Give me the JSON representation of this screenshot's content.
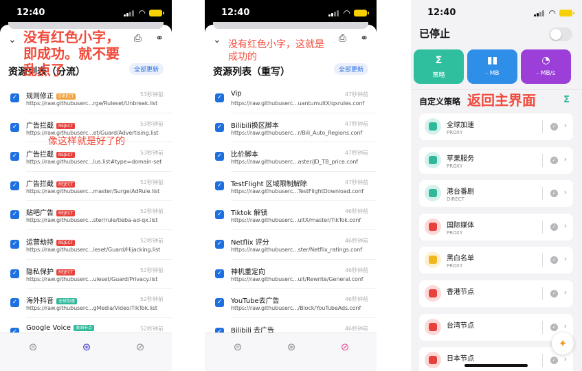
{
  "panel1": {
    "status": {
      "time": "12:40"
    },
    "title": "资源列表（分流）",
    "update_btn": "全部更新",
    "rows": [
      {
        "name": "规则修正",
        "badge": "DIRECT",
        "badge_color": "#f2a23c",
        "url": "https://raw.githubuserc...rge/Ruleset/Unbreak.list",
        "ago": "53秒钟前"
      },
      {
        "name": "广告拦截",
        "badge": "REJECT",
        "badge_color": "#e8413b",
        "url": "https://raw.githubuserc...et/Guard/Advertising.list",
        "ago": "53秒钟前"
      },
      {
        "name": "广告拦截",
        "badge": "REJECT",
        "badge_color": "#e8413b",
        "url": "https://raw.githubuserc...lus.list#type=domain-set",
        "ago": "53秒钟前"
      },
      {
        "name": "广告拦截",
        "badge": "REJECT",
        "badge_color": "#e8413b",
        "url": "https://raw.githubuserc...master/Surge/AdRule.list",
        "ago": "52秒钟前"
      },
      {
        "name": "贴吧广告",
        "badge": "REJECT",
        "badge_color": "#e8413b",
        "url": "https://raw.githubuserc...ster/rule/tieba-ad-qx.list",
        "ago": "52秒钟前"
      },
      {
        "name": "运营劫持",
        "badge": "REJECT",
        "badge_color": "#e8413b",
        "url": "https://raw.githubuserc...leset/Guard/Hijacking.list",
        "ago": "52秒钟前"
      },
      {
        "name": "隐私保护",
        "badge": "REJECT",
        "badge_color": "#e8413b",
        "url": "https://raw.githubuserc...uleset/Guard/Privacy.list",
        "ago": "52秒钟前"
      },
      {
        "name": "海外抖音",
        "badge": "全球加速",
        "badge_color": "#2fb89a",
        "url": "https://raw.githubuserc...gMedia/Video/TikTok.list",
        "ago": "52秒钟前"
      },
      {
        "name": "Google Voice",
        "badge": "美国节点",
        "badge_color": "#2fb89a",
        "url": "",
        "ago": "52秒钟前"
      }
    ],
    "annotations": {
      "big": "没有红色小字，\n即成功。就不要\n乱点了",
      "mid": "像这样就是好了的"
    }
  },
  "panel2": {
    "status": {
      "time": "12:40"
    },
    "title": "资源列表（重写）",
    "update_btn": "全部更新",
    "rows": [
      {
        "name": "Vip",
        "url": "https://raw.githubuserc...uantumultX/qxrules.conf",
        "ago": "47秒钟前"
      },
      {
        "name": "Bilibili换区脚本",
        "url": "https://raw.githubuserc...r/Bili_Auto_Regions.conf",
        "ago": "47秒钟前"
      },
      {
        "name": "比价脚本",
        "url": "https://raw.githubuserc...aster/JD_TB_price.conf",
        "ago": "47秒钟前"
      },
      {
        "name": "TestFlight 区域限制解除",
        "url": "https://raw.githubuserc...TestFlightDownload.conf",
        "ago": "47秒钟前"
      },
      {
        "name": "Tiktok 解锁",
        "url": "https://raw.githubuserc...ultX/master/TikTok.conf",
        "ago": "46秒钟前"
      },
      {
        "name": "Netflix 评分",
        "url": "https://raw.githubuserc...ster/Netflix_ratings.conf",
        "ago": "46秒钟前"
      },
      {
        "name": "神机重定向",
        "url": "https://raw.githubuserc...ult/Rewrite/General.conf",
        "ago": "46秒钟前"
      },
      {
        "name": "YouTube去广告",
        "url": "https://raw.githubuserc.../Block/YouTubeAds.conf",
        "ago": "46秒钟前"
      },
      {
        "name": "Bilibili 去广告",
        "url": "",
        "ago": "46秒钟前"
      }
    ],
    "annotations": {
      "mid": "没有红色小字，这就是\n成功的"
    }
  },
  "panel3": {
    "status": {
      "time": "12:40"
    },
    "title": "已停止",
    "tiles": [
      {
        "icon": "Σ",
        "label": "策略",
        "color": "#2fbf9e"
      },
      {
        "icon": "▮▮",
        "label": "- MB",
        "color": "#2e8ee8"
      },
      {
        "icon": "◔",
        "label": "- MB/s",
        "color": "#9b3fd8"
      }
    ],
    "section_title": "自定义策略",
    "annotation": "返回主界面",
    "policies": [
      {
        "name": "全球加速",
        "sub": "PROXY",
        "color": "#2fb89a"
      },
      {
        "name": "苹果服务",
        "sub": "PROXY",
        "color": "#2fb89a"
      },
      {
        "name": "港台番剧",
        "sub": "DIRECT",
        "color": "#2fb89a"
      },
      {
        "name": "国际媒体",
        "sub": "PROXY",
        "color": "#e8413b"
      },
      {
        "name": "黑白名单",
        "sub": "PROXY",
        "color": "#f2b51f"
      },
      {
        "name": "香港节点",
        "sub": "",
        "color": "#e8413b"
      },
      {
        "name": "台湾节点",
        "sub": "",
        "color": "#e8413b"
      },
      {
        "name": "日本节点",
        "sub": "",
        "color": "#e8413b"
      }
    ]
  }
}
